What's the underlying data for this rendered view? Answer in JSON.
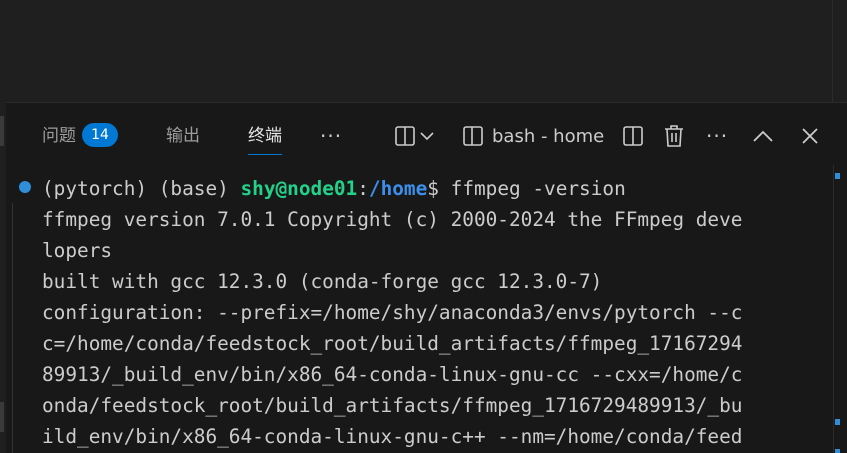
{
  "panel_tabs": {
    "problems_label": "问题",
    "problems_count": "14",
    "output_label": "输出",
    "terminal_label": "终端",
    "more_label": "···"
  },
  "terminal_toolbar": {
    "instance_label": "bash - home",
    "more_label": "···"
  },
  "terminal": {
    "prompt_prefix": "(pytorch) (base) ",
    "prompt_user_host": "shy@node01",
    "prompt_colon": ":",
    "prompt_path": "/home",
    "prompt_symbol": "$ ",
    "command": "ffmpeg -version",
    "output_lines": [
      "ffmpeg version 7.0.1 Copyright (c) 2000-2024 the FFmpeg deve",
      "lopers",
      "built with gcc 12.3.0 (conda-forge gcc 12.3.0-7)",
      "configuration: --prefix=/home/shy/anaconda3/envs/pytorch --c",
      "c=/home/conda/feedstock_root/build_artifacts/ffmpeg_17167294",
      "89913/_build_env/bin/x86_64-conda-linux-gnu-cc --cxx=/home/c",
      "onda/feedstock_root/build_artifacts/ffmpeg_1716729489913/_bu",
      "ild_env/bin/x86_64-conda-linux-gnu-c++ --nm=/home/conda/feed"
    ]
  },
  "icons": {
    "split": "split-terminal-icon",
    "dropdown": "chevron-down-icon",
    "terminal": "terminal-icon",
    "trash": "trash-icon",
    "maximize": "chevron-up-icon",
    "close": "close-icon"
  },
  "colors": {
    "accent": "#0078d4",
    "prompt_user": "#23d18b",
    "prompt_path": "#3b8eea",
    "background": "#181818"
  }
}
